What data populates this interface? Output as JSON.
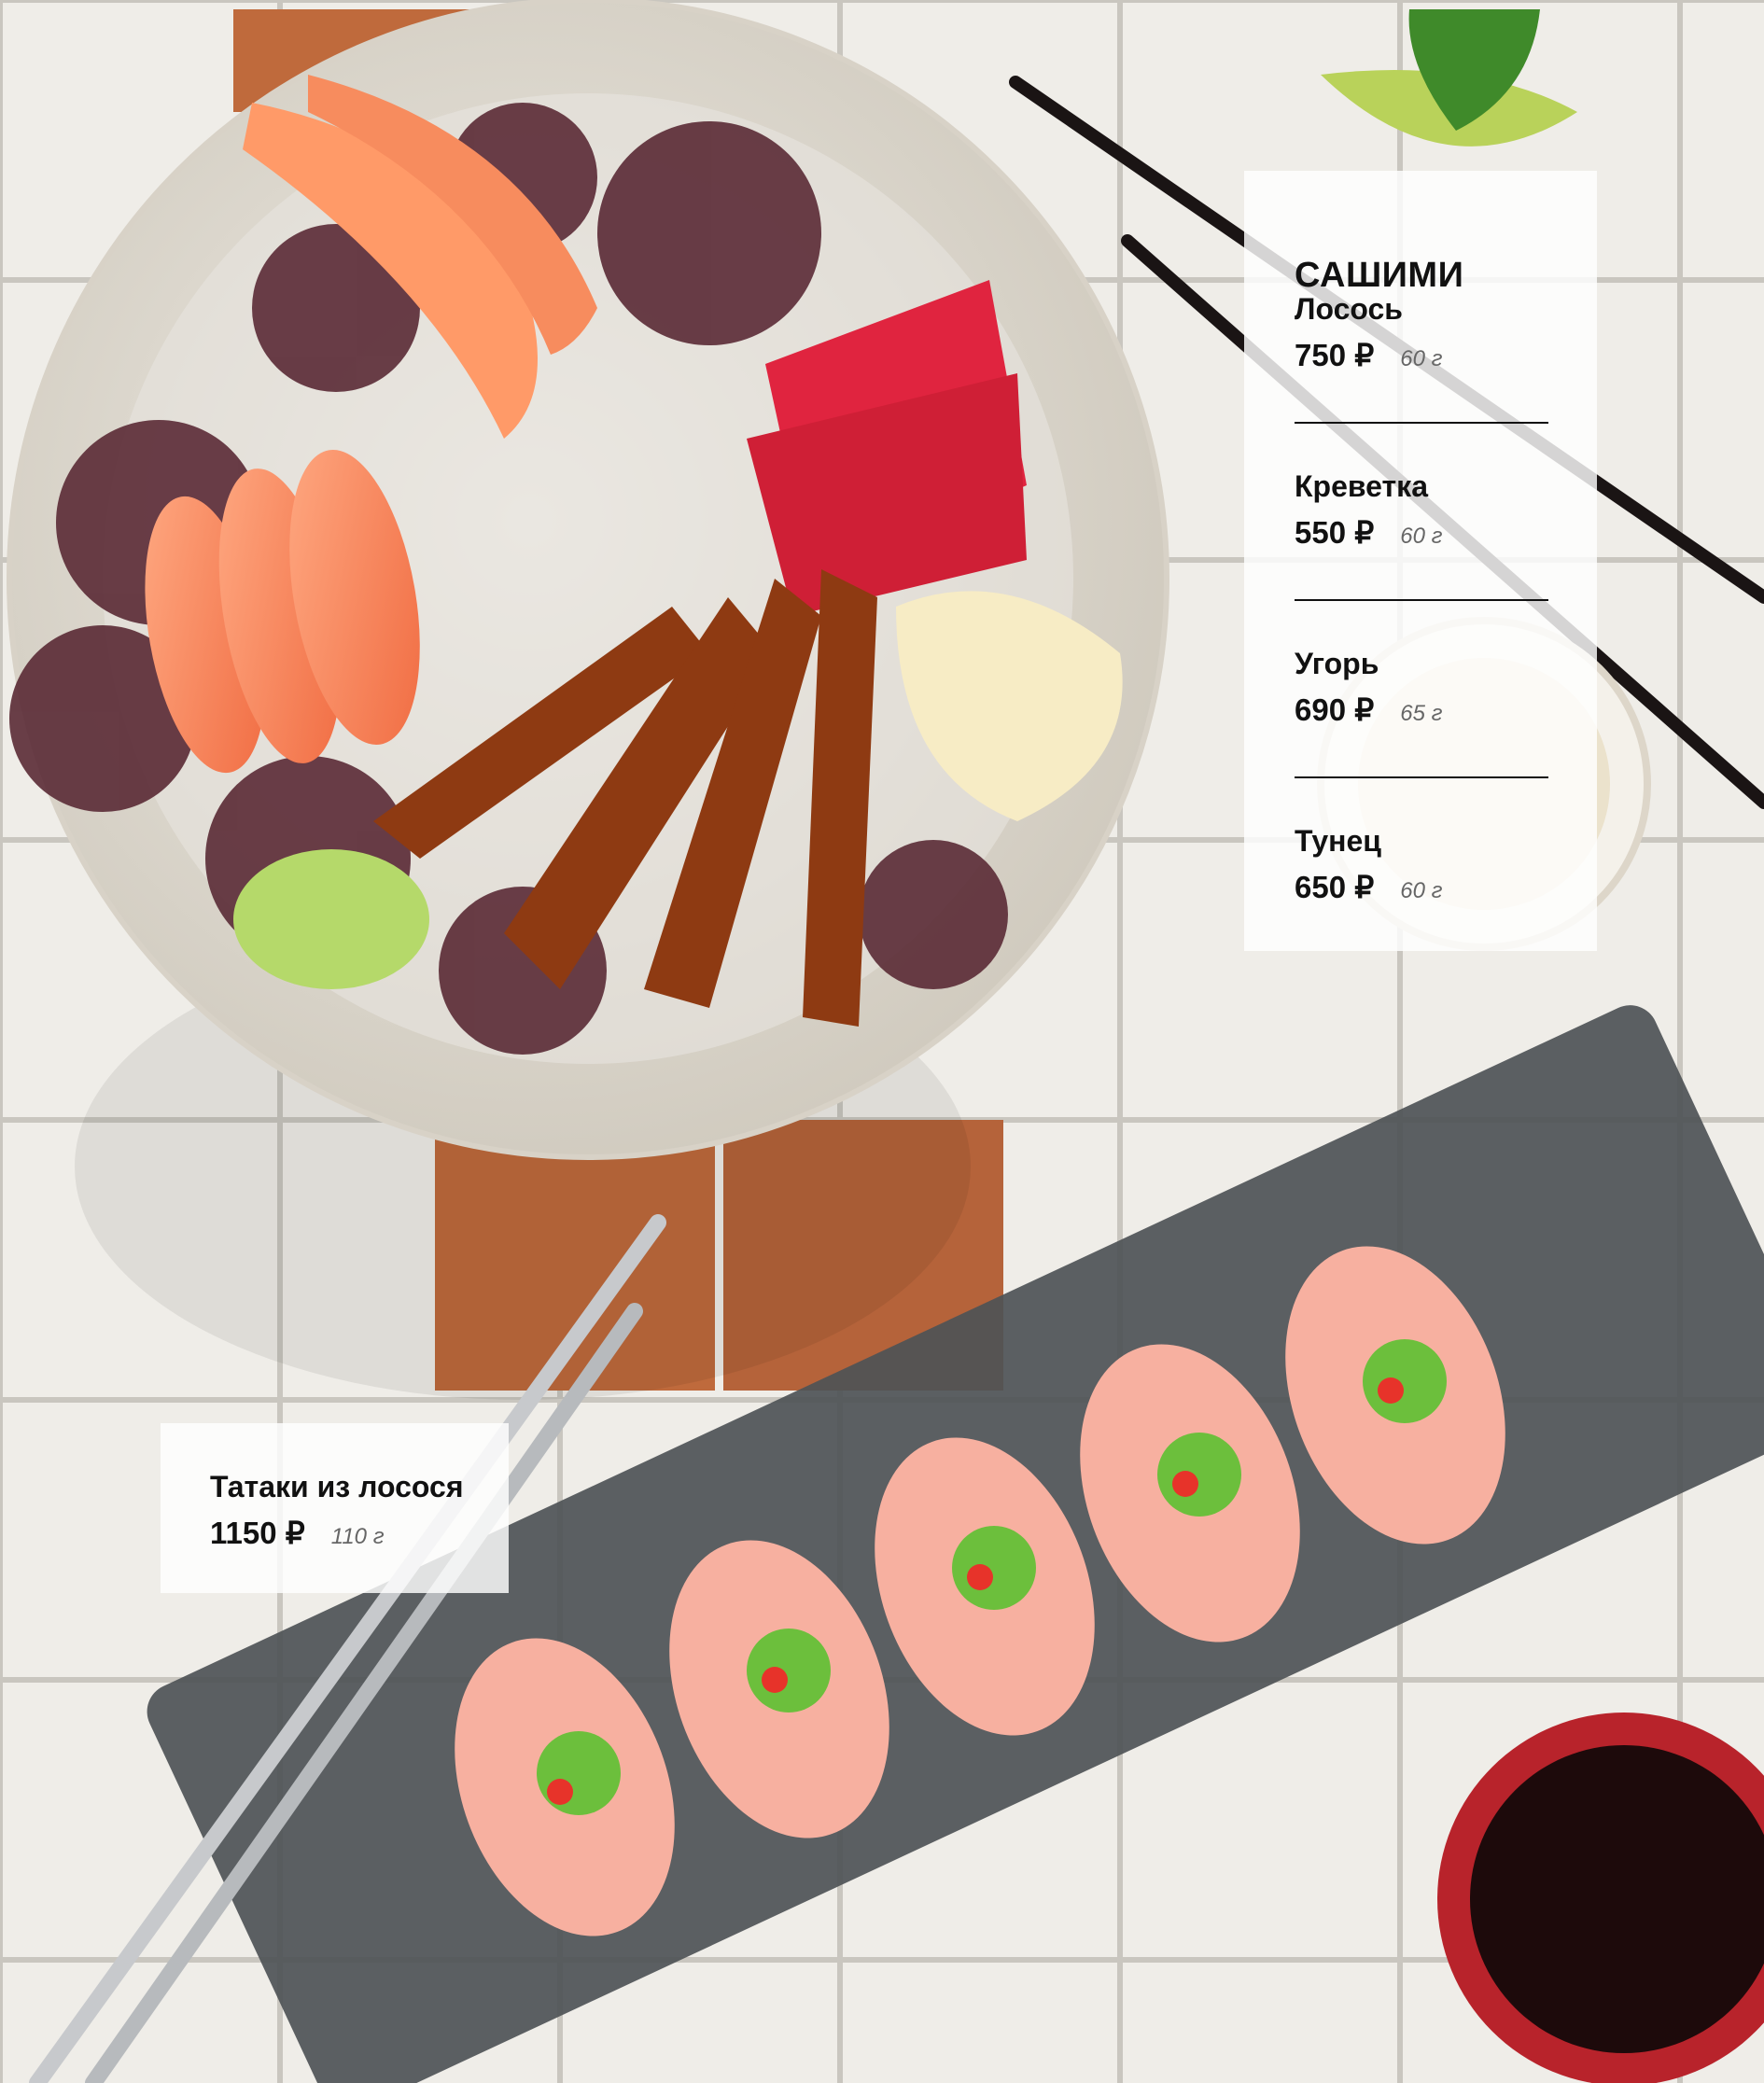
{
  "menu": {
    "section_title": "САШИМИ",
    "items": [
      {
        "name": "Лосось",
        "price": "750 ₽",
        "weight": "60 г"
      },
      {
        "name": "Креветка",
        "price": "550 ₽",
        "weight": "60 г"
      },
      {
        "name": "Угорь",
        "price": "690 ₽",
        "weight": "65 г"
      },
      {
        "name": "Тунец",
        "price": "650 ₽",
        "weight": "60 г"
      }
    ],
    "tataki": {
      "name": "Татаки из лосося",
      "price": "1150 ₽",
      "weight": "110 г"
    }
  },
  "colors": {
    "tile": "#eeece6",
    "terracotta": "#bf6a3c",
    "plate": "#e5e1d9",
    "tray": "#4e5256",
    "soy_bowl": "#b8232b"
  }
}
